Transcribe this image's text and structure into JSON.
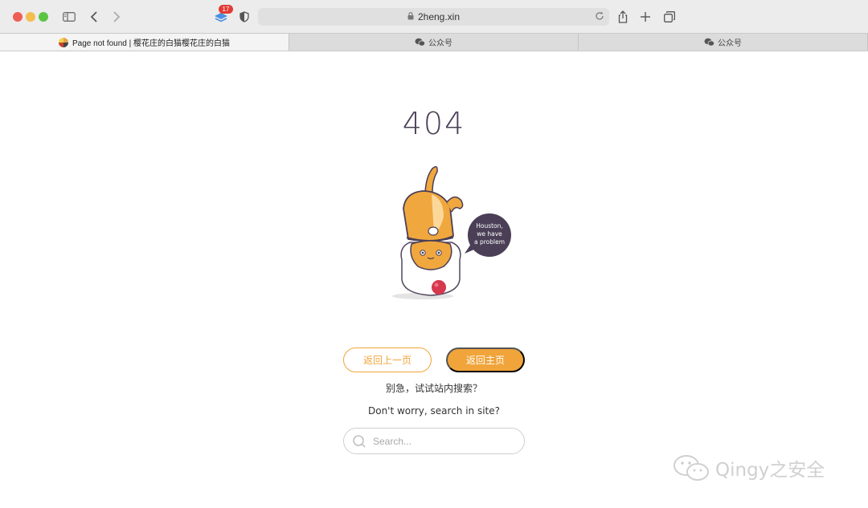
{
  "browser": {
    "tab_count_badge": "17",
    "address": "2heng.xin",
    "tabs": [
      {
        "label": "Page not found | 樱花庄的白猫樱花庄的白猫",
        "active": true
      },
      {
        "label": "公众号",
        "active": false
      },
      {
        "label": "公众号",
        "active": false
      }
    ],
    "traffic_colors": [
      "#ee5e56",
      "#f5bd4f",
      "#5dc443"
    ]
  },
  "page": {
    "heading": "404",
    "speech_bubble": "Houston, we have a problem",
    "back_button": "返回上一页",
    "home_button": "返回主页",
    "hint_cn": "别急，试试站内搜索？",
    "hint_en": "Don't worry, search in site?",
    "search_placeholder": "Search...",
    "accent_color": "#f0a43a"
  },
  "watermark": {
    "text": "Qingy之安全"
  },
  "icons": [
    "sidebar-icon",
    "back-icon",
    "forward-icon",
    "layers-icon",
    "shield-icon",
    "lock-icon",
    "reload-icon",
    "share-icon",
    "new-tab-icon",
    "tabs-overview-icon",
    "wechat-icon",
    "search-icon"
  ]
}
